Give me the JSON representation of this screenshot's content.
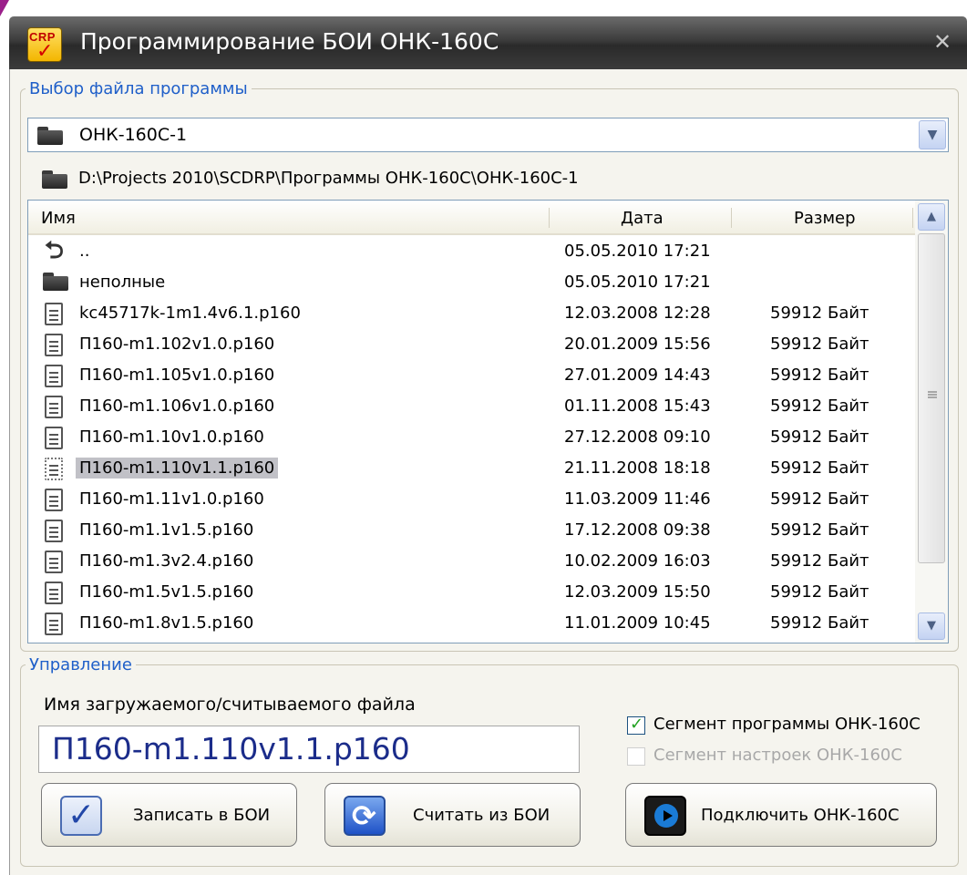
{
  "window": {
    "title": "Программирование БОИ ОНК-160С",
    "icon_text": "CRP",
    "close_glyph": "✕"
  },
  "file_group": {
    "legend": "Выбор файла программы",
    "folder_combo": "ОНК-160С-1",
    "path": "D:\\Projects 2010\\SCDRP\\Программы ОНК-160С\\ОНК-160С-1",
    "columns": {
      "name": "Имя",
      "date": "Дата",
      "size": "Размер"
    },
    "rows": [
      {
        "icon": "up-folder-icon",
        "name": "..",
        "date": "05.05.2010 17:21",
        "size": ""
      },
      {
        "icon": "folder-icon",
        "name": "неполные",
        "date": "05.05.2010 17:21",
        "size": ""
      },
      {
        "icon": "file-icon",
        "name": "kc45717k-1m1.4v6.1.p160",
        "date": "12.03.2008 12:28",
        "size": "59912 Байт"
      },
      {
        "icon": "file-icon",
        "name": "П160-m1.102v1.0.p160",
        "date": "20.01.2009 15:56",
        "size": "59912 Байт"
      },
      {
        "icon": "file-icon",
        "name": "П160-m1.105v1.0.p160",
        "date": "27.01.2009 14:43",
        "size": "59912 Байт"
      },
      {
        "icon": "file-icon",
        "name": "П160-m1.106v1.0.p160",
        "date": "01.11.2008 15:43",
        "size": "59912 Байт"
      },
      {
        "icon": "file-icon",
        "name": "П160-m1.10v1.0.p160",
        "date": "27.12.2008 09:10",
        "size": "59912 Байт"
      },
      {
        "icon": "file-icon",
        "name": "П160-m1.110v1.1.p160",
        "date": "21.11.2008 18:18",
        "size": "59912 Байт",
        "selected": true
      },
      {
        "icon": "file-icon",
        "name": "П160-m1.11v1.0.p160",
        "date": "11.03.2009 11:46",
        "size": "59912 Байт"
      },
      {
        "icon": "file-icon",
        "name": "П160-m1.1v1.5.p160",
        "date": "17.12.2008 09:38",
        "size": "59912 Байт"
      },
      {
        "icon": "file-icon",
        "name": "П160-m1.3v2.4.p160",
        "date": "10.02.2009 16:03",
        "size": "59912 Байт"
      },
      {
        "icon": "file-icon",
        "name": "П160-m1.5v1.5.p160",
        "date": "12.03.2009 15:50",
        "size": "59912 Байт"
      },
      {
        "icon": "file-icon",
        "name": "П160-m1.8v1.5.p160",
        "date": "11.01.2009 10:45",
        "size": "59912 Байт"
      }
    ]
  },
  "control_group": {
    "legend": "Управление",
    "filename_label": "Имя загружаемого/считываемого файла",
    "filename_value": "П160-m1.110v1.1.p160",
    "segment_program": {
      "label": "Сегмент программы ОНК-160С",
      "checked": true,
      "enabled": true
    },
    "segment_settings": {
      "label": "Сегмент настроек ОНК-160С",
      "checked": false,
      "enabled": false
    },
    "buttons": {
      "write": "Записать в БОИ",
      "read": "Считать из БОИ",
      "connect": "Подключить ОНК-160С"
    }
  },
  "colors": {
    "legend": "#1f5fc9",
    "selection": "#c1c1c7",
    "filename_text": "#1b2c8a",
    "check_mark": "#21a121"
  }
}
